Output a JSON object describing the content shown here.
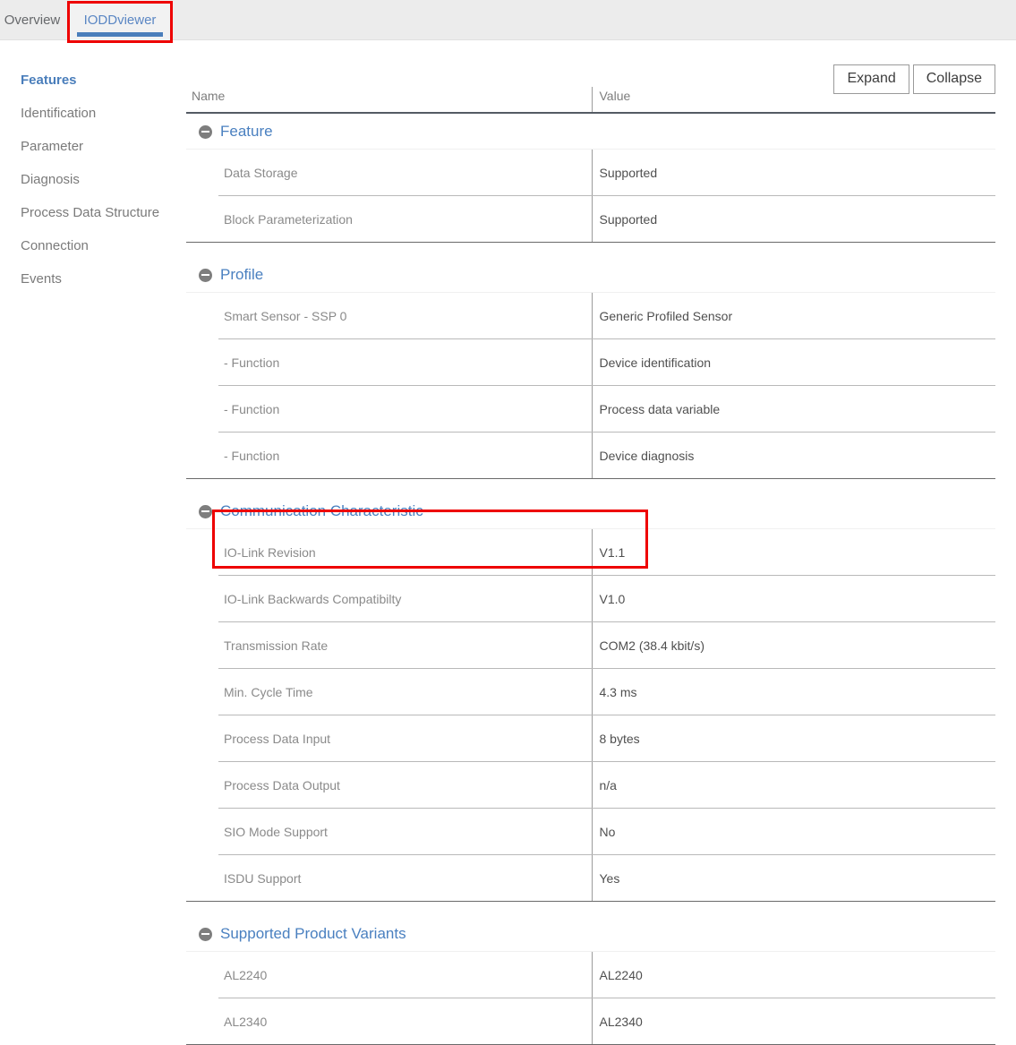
{
  "tabs": [
    {
      "label": "Overview",
      "active": false
    },
    {
      "label": "IODDviewer",
      "active": true
    }
  ],
  "sidebar": {
    "items": [
      {
        "label": "Features"
      },
      {
        "label": "Identification"
      },
      {
        "label": "Parameter"
      },
      {
        "label": "Diagnosis"
      },
      {
        "label": "Process Data Structure"
      },
      {
        "label": "Connection"
      },
      {
        "label": "Events"
      }
    ]
  },
  "toolbar": {
    "expand_label": "Expand",
    "collapse_label": "Collapse"
  },
  "table": {
    "headers": {
      "name": "Name",
      "value": "Value"
    },
    "groups": [
      {
        "title": "Feature",
        "rows": [
          {
            "name": "Data Storage",
            "value": "Supported"
          },
          {
            "name": "Block Parameterization",
            "value": "Supported"
          }
        ]
      },
      {
        "title": "Profile",
        "rows": [
          {
            "name": "Smart Sensor - SSP 0",
            "value": "Generic Profiled Sensor"
          },
          {
            "name": "- Function",
            "value": "Device identification"
          },
          {
            "name": "- Function",
            "value": "Process data variable"
          },
          {
            "name": "- Function",
            "value": "Device diagnosis"
          }
        ]
      },
      {
        "title": "Communication Characteristic",
        "rows": [
          {
            "name": "IO-Link Revision",
            "value": "V1.1"
          },
          {
            "name": "IO-Link Backwards Compatibilty",
            "value": "V1.0"
          },
          {
            "name": "Transmission Rate",
            "value": "COM2 (38.4 kbit/s)"
          },
          {
            "name": "Min. Cycle Time",
            "value": "4.3 ms"
          },
          {
            "name": "Process Data Input",
            "value": "8 bytes"
          },
          {
            "name": "Process Data Output",
            "value": "n/a"
          },
          {
            "name": "SIO Mode Support",
            "value": "No"
          },
          {
            "name": "ISDU Support",
            "value": "Yes"
          }
        ]
      },
      {
        "title": "Supported Product Variants",
        "rows": [
          {
            "name": "AL2240",
            "value": "AL2240"
          },
          {
            "name": "AL2340",
            "value": "AL2340"
          }
        ]
      }
    ]
  },
  "icons": {
    "group_collapse": "minus-circle-icon"
  },
  "colors": {
    "accent_blue": "#4a7ebb",
    "group_blue": "#4a80c0",
    "annotation_red": "#ee0000",
    "tabbar_bg": "#ececec",
    "text_gray": "#7a7a7a"
  }
}
